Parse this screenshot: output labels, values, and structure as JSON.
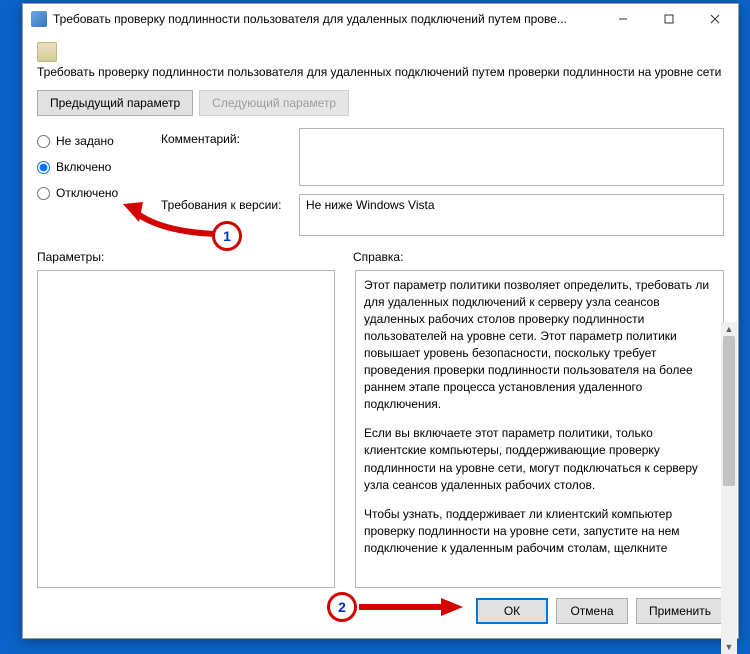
{
  "window": {
    "title": "Требовать проверку подлинности пользователя для удаленных подключений путем прове..."
  },
  "policy": {
    "full_title": "Требовать проверку подлинности пользователя для удаленных подключений путем проверки подлинности на уровне сети"
  },
  "nav": {
    "prev": "Предыдущий параметр",
    "next": "Следующий параметр"
  },
  "state": {
    "not_configured": "Не задано",
    "enabled": "Включено",
    "disabled": "Отключено",
    "selected": "enabled"
  },
  "fields": {
    "comment_label": "Комментарий:",
    "comment_value": "",
    "version_label": "Требования к версии:",
    "version_value": "Не ниже Windows Vista"
  },
  "panes": {
    "options_label": "Параметры:",
    "help_label": "Справка:",
    "help_p1": "Этот параметр политики позволяет определить, требовать ли для удаленных подключений к серверу узла сеансов удаленных рабочих столов проверку подлинности пользователей на уровне сети. Этот параметр политики повышает уровень безопасности, поскольку требует проведения проверки подлинности пользователя на более раннем этапе процесса установления удаленного подключения.",
    "help_p2": "Если вы включаете этот параметр политики, только клиентские компьютеры, поддерживающие проверку подлинности на уровне сети, могут подключаться к серверу узла сеансов удаленных рабочих столов.",
    "help_p3": "Чтобы узнать, поддерживает ли клиентский компьютер проверку подлинности на уровне сети, запустите на нем подключение к удаленным рабочим столам, щелкните"
  },
  "buttons": {
    "ok": "ОК",
    "cancel": "Отмена",
    "apply": "Применить"
  },
  "annotations": {
    "badge1": "1",
    "badge2": "2"
  }
}
